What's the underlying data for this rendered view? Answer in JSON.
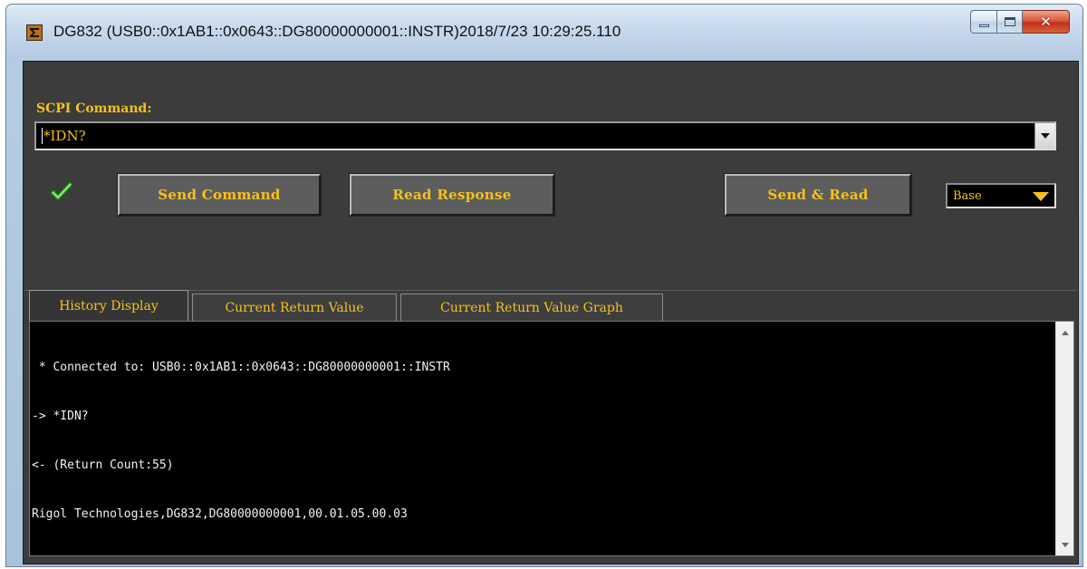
{
  "window": {
    "title": "DG832 (USB0::0x1AB1::0x0643::DG80000000001::INSTR)2018/7/23 10:29:25.110",
    "app_icon": "sigma-icon",
    "controls": {
      "minimize": "minimize-icon",
      "maximize": "maximize-icon",
      "close": "close-icon"
    }
  },
  "command": {
    "label": "SCPI Command:",
    "value": "*IDN?"
  },
  "status_icon": "check-icon",
  "buttons": {
    "send": "Send Command",
    "read": "Read Response",
    "send_read": "Send & Read"
  },
  "format_select": {
    "selected": "Base"
  },
  "tabs": [
    {
      "label": "History Display",
      "active": true
    },
    {
      "label": "Current Return Value",
      "active": false
    },
    {
      "label": "Current Return Value Graph",
      "active": false
    }
  ],
  "history": {
    "lines": [
      " * Connected to: USB0::0x1AB1::0x0643::DG80000000001::INSTR",
      "-> *IDN?",
      "<- (Return Count:55)",
      "Rigol Technologies,DG832,DG80000000001,00.01.05.00.03"
    ]
  },
  "colors": {
    "accent_text": "#f4c21c",
    "panel_bg": "#3c3c3c",
    "console_bg": "#000000",
    "console_text": "#f2f2f2",
    "check_green": "#3cbf2a"
  }
}
